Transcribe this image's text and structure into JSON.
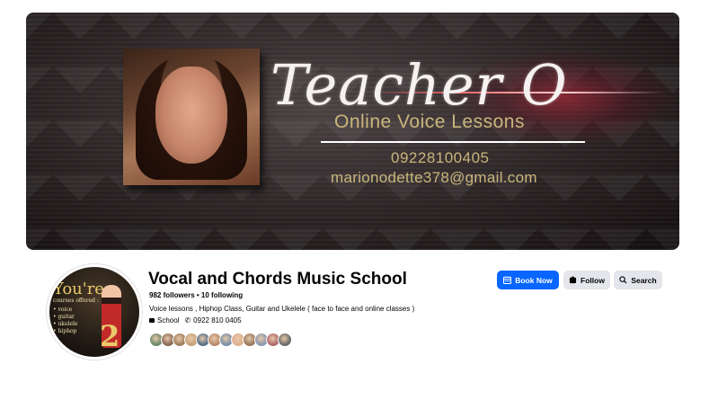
{
  "cover": {
    "title": "Teacher O",
    "subtitle": "Online Voice Lessons",
    "phone": "09228100405",
    "email": "marionodette378@gmail.com"
  },
  "avatar": {
    "line1": "You're",
    "line2": "courses offered :",
    "items": "• voice\n• guitar\n• ukelele\n• hiphop",
    "number": "2"
  },
  "page": {
    "name": "Vocal and Chords Music School",
    "followers": "982 followers • 10 following",
    "description": "Voice lessons , Hiphop Class, Guitar and Ukelele ( face to face and online classes )",
    "category": "School",
    "phone": "0922 810 0405"
  },
  "buttons": {
    "book": "Book Now",
    "follow": "Follow",
    "search": "Search"
  },
  "friend_avatars": [
    "#6d8a6a",
    "#8a6a55",
    "#a08060",
    "#c9a27a",
    "#59708a",
    "#b88a6a",
    "#7a8fa8",
    "#e0b090",
    "#9a7a60",
    "#8a9ab0",
    "#b06a70",
    "#6a6a6a"
  ],
  "colors": {
    "accent": "#0866ff",
    "secondary_button": "#e4e6eb",
    "cover_text_gold": "#c9b67b"
  }
}
